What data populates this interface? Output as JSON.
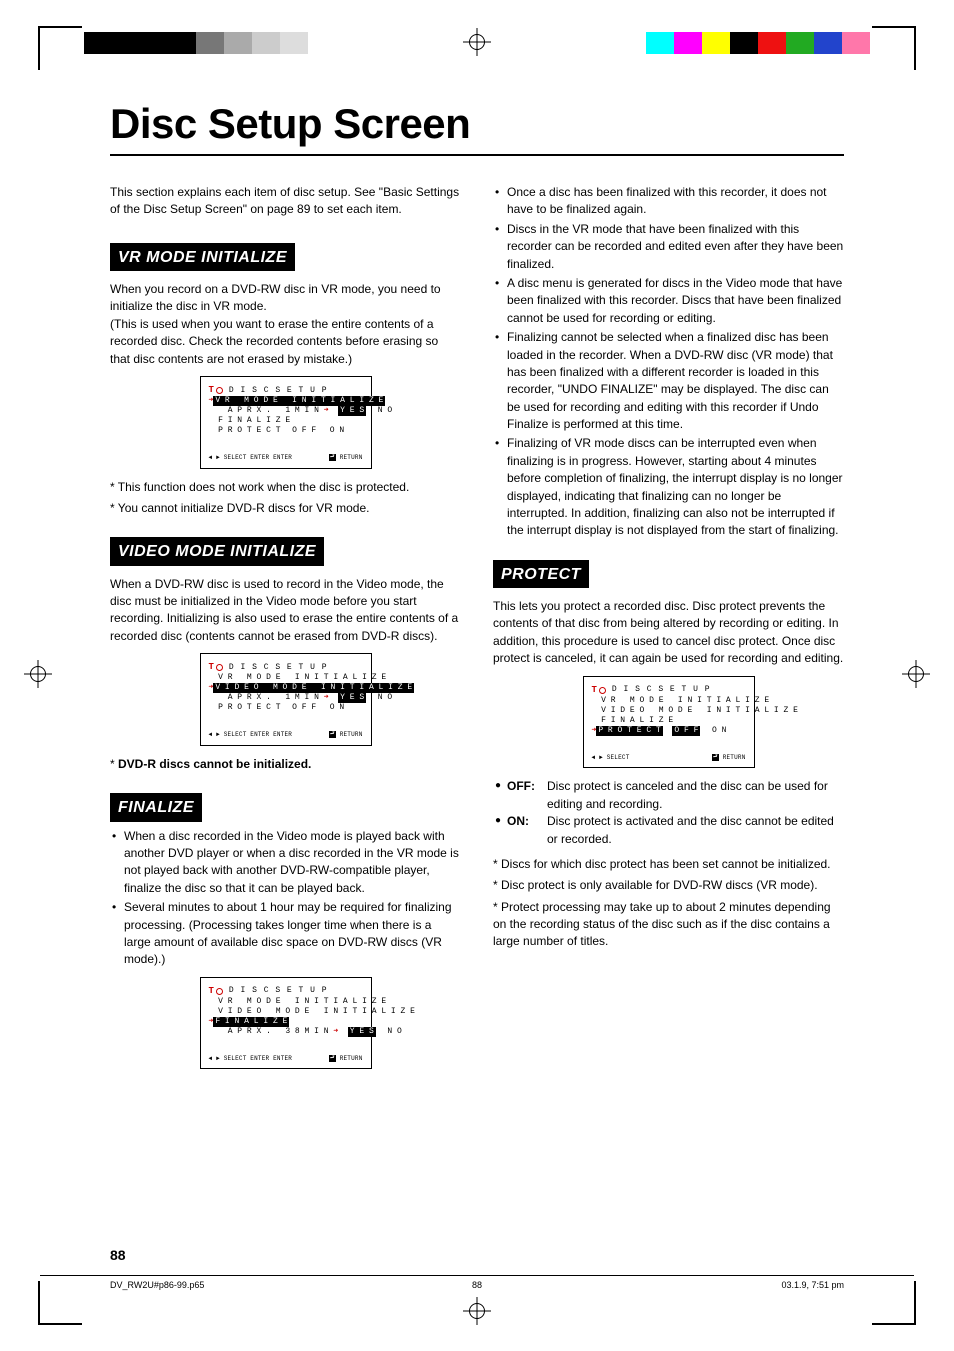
{
  "page": {
    "title": "Disc Setup Screen",
    "number": "88",
    "intro": "This section explains each item of disc setup. See \"Basic Settings of the Disc Setup Screen\" on page 89 to set each item."
  },
  "footer": {
    "file": "DV_RW2U#p86-99.p65",
    "page": "88",
    "timestamp": "03.1.9, 7:51 pm"
  },
  "vr": {
    "heading": "VR MODE INITIALIZE",
    "body": "When you record on a DVD-RW disc in VR mode, you need to initialize the disc in VR mode.\n(This is used when you want to erase the entire contents of a recorded disc. Check the recorded contents before erasing so that disc contents are not erased by mistake.)",
    "notes": [
      "* This function does not work when the disc is protected.",
      "* You cannot initialize DVD-R discs for VR mode."
    ],
    "osd": {
      "title": "DISC SETUP",
      "rows": [
        {
          "label": "VR MODE INITIALIZE",
          "hl": true
        },
        {
          "label": "APRX. 1MIN",
          "opts": [
            "YES",
            "NO"
          ],
          "sel": 0,
          "indent": true
        },
        {
          "label": "FINALIZE"
        },
        {
          "label": "PROTECT",
          "opts": [
            "OFF",
            "ON"
          ]
        }
      ],
      "foot_left": "SELECT  ENTER ENTER",
      "foot_right": "RETURN"
    }
  },
  "video": {
    "heading": "VIDEO MODE INITIALIZE",
    "body": "When a DVD-RW disc is used to record in the Video mode, the disc must be initialized in the Video mode before you start recording. Initializing is also used to erase the entire contents of a recorded disc (contents cannot be erased from DVD-R discs).",
    "note_strong": "DVD-R discs cannot be initialized.",
    "osd": {
      "title": "DISC SETUP",
      "rows": [
        {
          "label": "VR MODE INITIALIZE"
        },
        {
          "label": "VIDEO MODE INITIALIZE",
          "hl": true
        },
        {
          "label": "APRX. 1MIN",
          "opts": [
            "YES",
            "NO"
          ],
          "sel": 0,
          "indent": true
        },
        {
          "label": "PROTECT",
          "opts": [
            "OFF",
            "ON"
          ]
        }
      ],
      "foot_left": "SELECT  ENTER ENTER",
      "foot_right": "RETURN"
    }
  },
  "finalize": {
    "heading": "FINALIZE",
    "bullets": [
      "When a disc recorded in the Video mode is played back with another DVD player or when a disc recorded in the VR mode is not played back with another DVD-RW-compatible player, finalize the disc so that it can be played back.",
      "Several minutes to about 1 hour may be required for finalizing processing. (Processing takes longer time when there is a large amount of available disc space on DVD-RW discs (VR mode).)"
    ],
    "osd": {
      "title": "DISC SETUP",
      "rows": [
        {
          "label": "VR MODE INITIALIZE"
        },
        {
          "label": "VIDEO MODE INITIALIZE"
        },
        {
          "label": "FINALIZE",
          "hl": true
        },
        {
          "label": "APRX. 38MIN",
          "opts": [
            "YES",
            "NO"
          ],
          "sel": 0,
          "indent": true
        }
      ],
      "foot_left": "SELECT  ENTER ENTER",
      "foot_right": "RETURN"
    },
    "after_bullets": [
      "Once a disc has been finalized with this recorder, it does not have to be finalized again.",
      "Discs in the VR mode that have been finalized with this recorder can be recorded and edited even after they have been finalized.",
      "A disc menu is generated for discs in the Video mode that have been finalized with this recorder. Discs that have been finalized cannot be used for recording or editing.",
      "Finalizing cannot be selected when a finalized disc has been loaded in the recorder. When a DVD-RW disc (VR mode) that has been finalized with a different recorder is loaded in this recorder, \"UNDO FINALIZE\" may be displayed. The disc can be used for recording and editing with this recorder if Undo Finalize is performed at this time.",
      "Finalizing of VR mode discs can be interrupted even when finalizing is in progress. However, starting about 4 minutes before completion of finalizing, the interrupt display is no longer displayed, indicating that finalizing can no longer be interrupted. In addition, finalizing can also not be interrupted if the interrupt display is not displayed from the start of finalizing."
    ]
  },
  "protect": {
    "heading": "PROTECT",
    "body": "This lets you protect a recorded disc. Disc protect prevents the contents of that disc from being altered by recording or editing. In addition, this procedure is used to cancel disc protect. Once disc protect is canceled, it can again be used for recording and editing.",
    "osd": {
      "title": "DISC SETUP",
      "rows": [
        {
          "label": "VR MODE INITIALIZE"
        },
        {
          "label": "VIDEO MODE INITIALIZE"
        },
        {
          "label": "FINALIZE"
        },
        {
          "label": "PROTECT",
          "hl": true,
          "opts": [
            "OFF",
            "ON"
          ],
          "sel": 0
        }
      ],
      "foot_left": "SELECT",
      "foot_right": "RETURN"
    },
    "defs": [
      {
        "k": "OFF:",
        "v": "Disc protect is canceled and the disc can be used for editing and recording."
      },
      {
        "k": "ON:",
        "v": "Disc protect is activated and the disc cannot be edited or recorded."
      }
    ],
    "notes": [
      "* Discs for which disc protect has been set cannot be initialized.",
      "* Disc protect is only available for DVD-RW discs (VR mode).",
      "* Protect processing may take up to about 2 minutes depending on the recording status of the disc such as if the disc contains a large number of titles."
    ]
  }
}
